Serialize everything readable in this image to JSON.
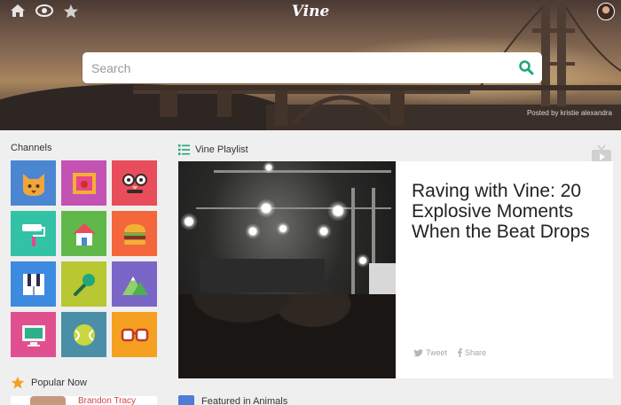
{
  "app": {
    "logo_text": "Vine"
  },
  "topbar": {
    "icons": [
      "home-icon",
      "explore-eye-icon",
      "star-icon"
    ]
  },
  "hero": {
    "credit_text": "Posted by kristie alexandra"
  },
  "search": {
    "placeholder": "Search",
    "value": ""
  },
  "channels": {
    "title": "Channels",
    "tiles": [
      {
        "icon": "cat-icon",
        "bg": "#4b86d3"
      },
      {
        "icon": "picture-frame-icon",
        "bg": "#c352b3"
      },
      {
        "icon": "disguise-glasses-icon",
        "bg": "#e84d5b"
      },
      {
        "icon": "paint-roller-icon",
        "bg": "#33c2a5"
      },
      {
        "icon": "house-icon",
        "bg": "#61b84a"
      },
      {
        "icon": "burger-icon",
        "bg": "#f4673c"
      },
      {
        "icon": "piano-keys-icon",
        "bg": "#3d8be0"
      },
      {
        "icon": "microphone-icon",
        "bg": "#b9c733"
      },
      {
        "icon": "mountains-icon",
        "bg": "#7a66c6"
      },
      {
        "icon": "monitor-icon",
        "bg": "#e0508e"
      },
      {
        "icon": "tennis-ball-icon",
        "bg": "#4a8fa6"
      },
      {
        "icon": "glasses-icon",
        "bg": "#f6a021"
      }
    ]
  },
  "playlist": {
    "title": "Vine Playlist",
    "headline": "Raving with Vine: 20 Explosive Moments When the Beat Drops",
    "tweet_label": "Tweet",
    "share_label": "Share"
  },
  "popular": {
    "title": "Popular Now",
    "first_user": "Brandon Tracy"
  },
  "featured": {
    "title": "Featured in Animals"
  },
  "colors": {
    "accent": "#1fa87a",
    "page_bg": "#efefef"
  }
}
